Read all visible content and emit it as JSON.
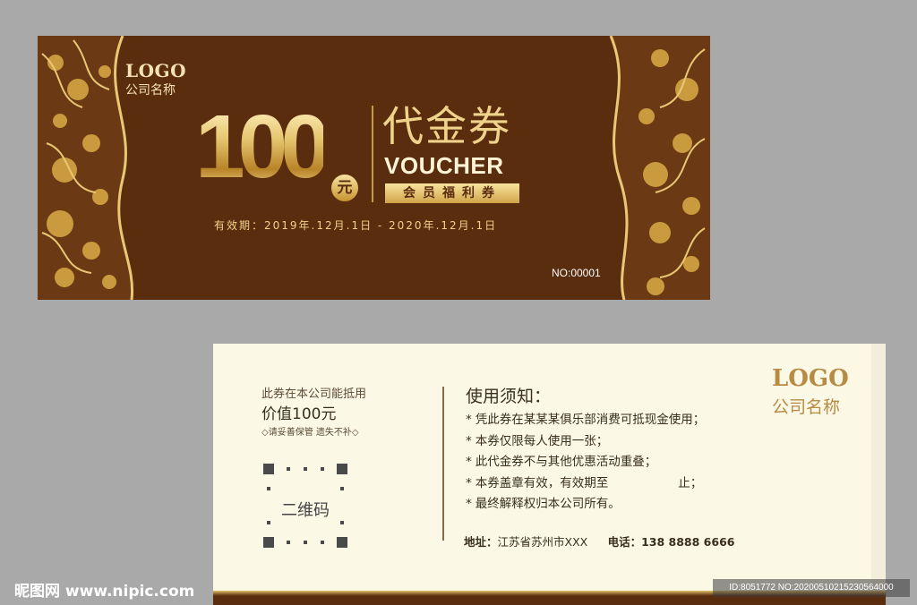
{
  "front": {
    "logo": "LOGO",
    "company": "公司名称",
    "amount": "100",
    "currency": "元",
    "title_cn": "代金券",
    "title_en": "VOUCHER",
    "member_tag": "会员福利券",
    "validity": "有效期：2019年.12月.1日 - 2020年.12月.1日",
    "serial": "NO:00001"
  },
  "back": {
    "value_line1": "此券在本公司能抵用",
    "value_line2": "价值100元",
    "keep_note": "◇请妥善保管 遗失不补◇",
    "qr_label": "二维码",
    "notice_title": "使用须知：",
    "rules": [
      "凭此券在某某某俱乐部消费可抵现金使用；",
      "本券仅限每人使用一张；",
      "此代金券不与其他优惠活动重叠；",
      "本券盖章有效，有效期至",
      "最终解释权归本公司所有。"
    ],
    "rule4_suffix": "止；",
    "address_label": "地址：",
    "address_value": "江苏省苏州市XXX",
    "phone_label": "电话：",
    "phone_value": "138 8888 6666",
    "logo": "LOGO",
    "company": "公司名称"
  },
  "watermark": {
    "site": "昵图网 www.nipic.com",
    "id": "ID:8051772 NO:20200510215230564000"
  },
  "colors": {
    "brown": "#5b2d0f",
    "gold": "#e7c872",
    "cream": "#fbf8e6"
  }
}
